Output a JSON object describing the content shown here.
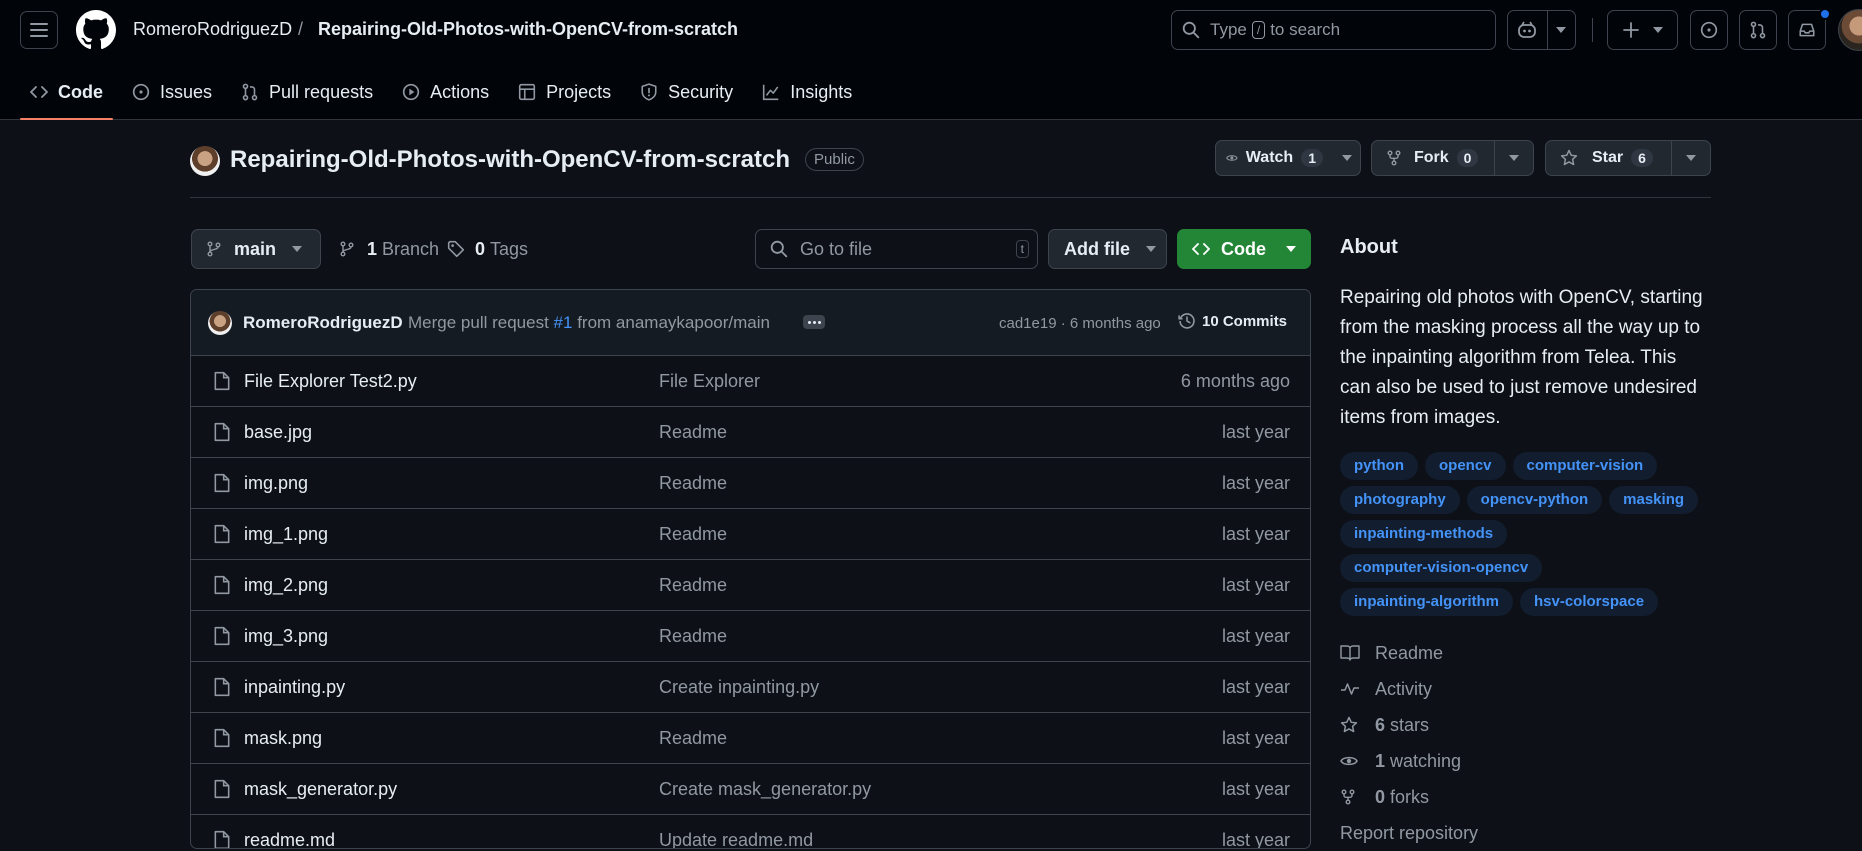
{
  "header": {
    "owner": "RomeroRodriguezD",
    "separator": "/",
    "repo": "Repairing-Old-Photos-with-OpenCV-from-scratch",
    "search_prefix": "Type",
    "search_key": "/",
    "search_suffix": "to search"
  },
  "tabs": [
    {
      "label": "Code",
      "icon": "code-icon",
      "active": true
    },
    {
      "label": "Issues",
      "icon": "issue-icon"
    },
    {
      "label": "Pull requests",
      "icon": "pull-request-icon"
    },
    {
      "label": "Actions",
      "icon": "play-icon"
    },
    {
      "label": "Projects",
      "icon": "table-icon"
    },
    {
      "label": "Security",
      "icon": "shield-icon"
    },
    {
      "label": "Insights",
      "icon": "graph-icon"
    }
  ],
  "repo": {
    "title": "Repairing-Old-Photos-with-OpenCV-from-scratch",
    "visibility": "Public",
    "watch_label": "Watch",
    "watch_count": "1",
    "fork_label": "Fork",
    "fork_count": "0",
    "star_label": "Star",
    "star_count": "6"
  },
  "toolbar": {
    "branch": "main",
    "branches_count": "1",
    "branches_label": "Branch",
    "tags_count": "0",
    "tags_label": "Tags",
    "goto_placeholder": "Go to file",
    "goto_key": "t",
    "add_file": "Add file",
    "code": "Code"
  },
  "commit": {
    "author": "RomeroRodriguezD",
    "message_prefix": "Merge pull request",
    "pr": "#1",
    "message_suffix": "from anamaykapoor/main",
    "meta": "cad1e19 · 6 months ago",
    "commits": "10 Commits"
  },
  "files": [
    {
      "name": "File Explorer Test2.py",
      "message": "File Explorer",
      "date": "6 months ago"
    },
    {
      "name": "base.jpg",
      "message": "Readme",
      "date": "last year"
    },
    {
      "name": "img.png",
      "message": "Readme",
      "date": "last year"
    },
    {
      "name": "img_1.png",
      "message": "Readme",
      "date": "last year"
    },
    {
      "name": "img_2.png",
      "message": "Readme",
      "date": "last year"
    },
    {
      "name": "img_3.png",
      "message": "Readme",
      "date": "last year"
    },
    {
      "name": "inpainting.py",
      "message": "Create inpainting.py",
      "date": "last year"
    },
    {
      "name": "mask.png",
      "message": "Readme",
      "date": "last year"
    },
    {
      "name": "mask_generator.py",
      "message": "Create mask_generator.py",
      "date": "last year"
    },
    {
      "name": "readme.md",
      "message": "Update readme.md",
      "date": "last year"
    }
  ],
  "about": {
    "heading": "About",
    "description": "Repairing old photos with OpenCV, starting from the masking process all the way up to the inpainting algorithm from Telea. This can also be used to just remove undesired items from images.",
    "topics": [
      "python",
      "opencv",
      "computer-vision",
      "photography",
      "opencv-python",
      "masking",
      "inpainting-methods",
      "computer-vision-opencv",
      "inpainting-algorithm",
      "hsv-colorspace"
    ],
    "readme": "Readme",
    "activity": "Activity",
    "stars_count": "6",
    "stars_label": "stars",
    "watching_count": "1",
    "watching_label": "watching",
    "forks_count": "0",
    "forks_label": "forks",
    "report": "Report repository"
  },
  "colors": {
    "background": "#0d1117",
    "header": "#010409",
    "accent_tab": "#f78166",
    "code_button": "#238636",
    "link": "#4493f8"
  }
}
